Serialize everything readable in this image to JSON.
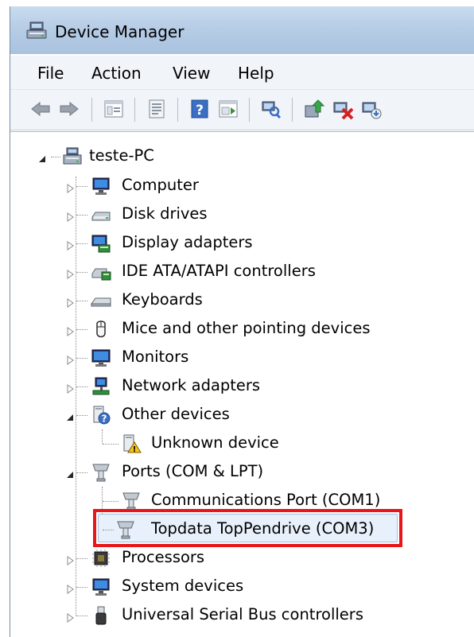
{
  "window": {
    "title": "Device Manager"
  },
  "menu": [
    "File",
    "Action",
    "View",
    "Help"
  ],
  "toolbar_icons": [
    "back-arrow-icon",
    "forward-arrow-icon",
    "show-hide-tree-icon",
    "properties-icon",
    "help-icon",
    "action-pane-icon",
    "scan-hardware-icon",
    "update-driver-icon",
    "uninstall-icon",
    "enable-disable-icon"
  ],
  "tree": {
    "root": "teste-PC",
    "categories": {
      "computer": "Computer",
      "disk": "Disk drives",
      "display": "Display adapters",
      "ide": "IDE ATA/ATAPI controllers",
      "keyboards": "Keyboards",
      "mice": "Mice and other pointing devices",
      "monitors": "Monitors",
      "network": "Network adapters",
      "other": "Other devices",
      "unknown": "Unknown device",
      "ports": "Ports (COM & LPT)",
      "com1": "Communications Port (COM1)",
      "com3": "Topdata TopPendrive (COM3)",
      "processors": "Processors",
      "system": "System devices",
      "usb": "Universal Serial Bus controllers"
    }
  },
  "colors": {
    "highlight": "#e8161b",
    "selection": "#e8f1fb",
    "titlebar": "#b7cde6"
  }
}
